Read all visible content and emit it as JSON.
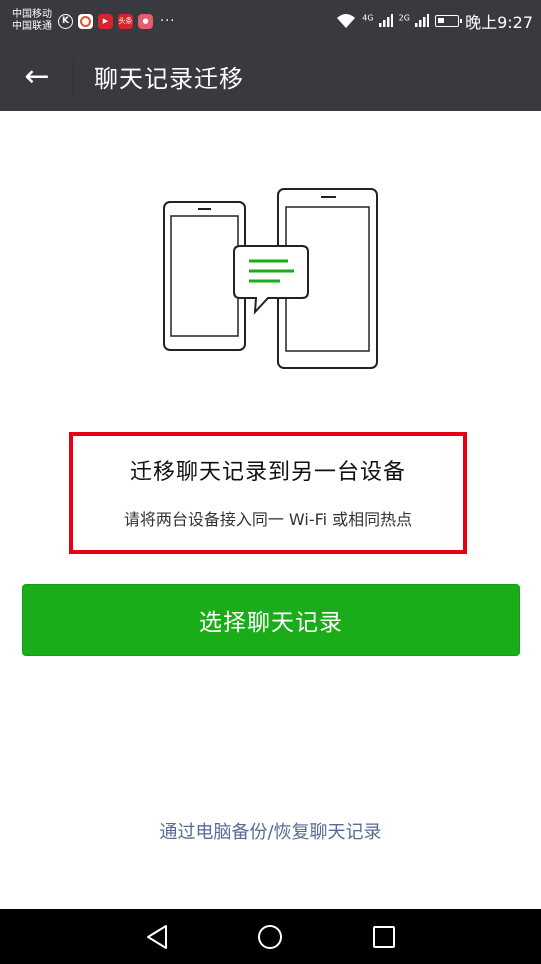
{
  "status_bar": {
    "carrier1": "中国移动",
    "carrier2": "中国联通",
    "notif_icons": [
      "k-app-icon",
      "browser-icon",
      "video-icon",
      "toutiao-icon",
      "red-app-icon"
    ],
    "toutiao_text": "头条",
    "more": "···",
    "signal1": "4G",
    "signal2": "2G",
    "time": "晚上9:27"
  },
  "header": {
    "back_icon": "←",
    "title": "聊天记录迁移"
  },
  "main": {
    "heading": "迁移聊天记录到另一台设备",
    "subheading": "请将两台设备接入同一 Wi-Fi 或相同热点",
    "primary_button": "选择聊天记录",
    "pc_link": "通过电脑备份/恢复聊天记录"
  },
  "colors": {
    "bar": "#393a3f",
    "accent_green": "#1aad19",
    "link": "#576b95",
    "highlight": "#e60012"
  }
}
